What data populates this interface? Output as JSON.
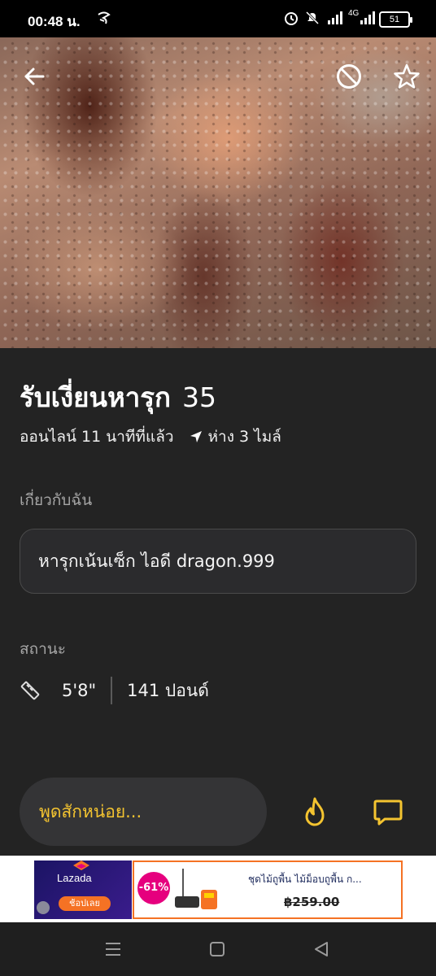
{
  "status_bar": {
    "time": "00:48 น.",
    "network_label": "4G",
    "battery": "51"
  },
  "profile": {
    "name": "รับเงี่ยนหารุก",
    "age": "35",
    "online_status": "ออนไลน์ 11 นาทีที่แล้ว",
    "distance": "ห่าง 3 ไมล์"
  },
  "about": {
    "label": "เกี่ยวกับฉัน",
    "text": "หารุกเน้นเซ็ก ไอดี dragon.999"
  },
  "stats": {
    "label": "สถานะ",
    "height": "5'8\"",
    "weight": "141 ปอนด์"
  },
  "chat": {
    "placeholder": "พูดสักหน่อย..."
  },
  "ad": {
    "brand": "Lazada",
    "shop_button": "ช้อปเลย",
    "discount": "-61%",
    "product_title": "ชุดไม้ถูพื้น ไม้ม็อบถูพื้น ก...",
    "price": "฿259.00"
  },
  "colors": {
    "accent": "#f4c430",
    "background": "#232323"
  },
  "icons": {
    "back": "arrow-left-icon",
    "block": "block-icon",
    "favorite": "star-icon",
    "distance": "navigation-arrow-icon",
    "height": "ruler-icon",
    "tap": "flame-icon",
    "message": "chat-bubble-icon"
  }
}
